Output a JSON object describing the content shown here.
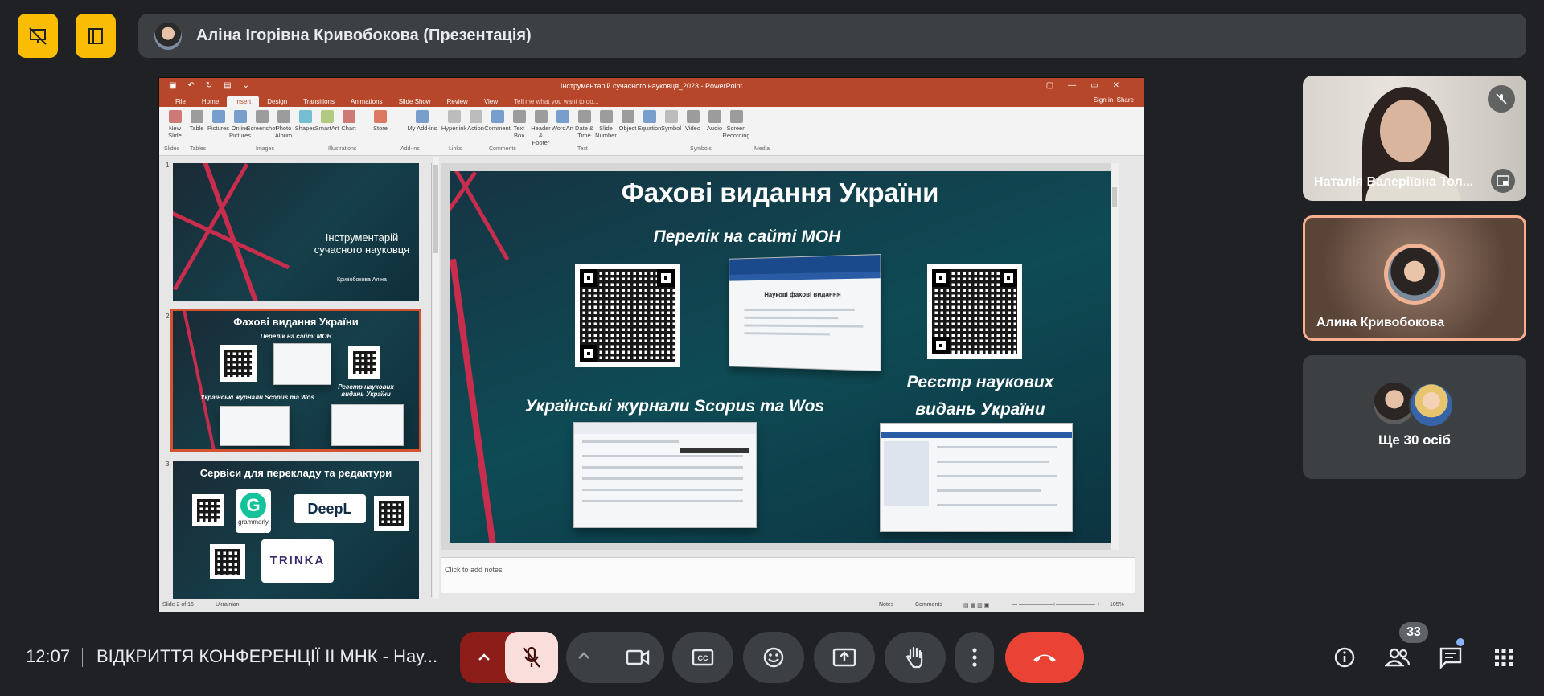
{
  "top": {
    "presenter_name": "Аліна Ігорівна Кривобокова (Презентація)"
  },
  "ppt": {
    "window_title": "Інструментарій сучасного науковця_2023 - PowerPoint",
    "tabs": [
      "File",
      "Home",
      "Insert",
      "Design",
      "Transitions",
      "Animations",
      "Slide Show",
      "Review",
      "View"
    ],
    "active_tab": "Insert",
    "tell_me": "Tell me what you want to do...",
    "sign_in": "Sign in",
    "share": "Share",
    "ribbon": [
      {
        "label": "New Slide"
      },
      {
        "label": "Table"
      },
      {
        "label": "Pictures"
      },
      {
        "label": "Online Pictures"
      },
      {
        "label": "Screenshot"
      },
      {
        "label": "Photo Album"
      },
      {
        "label": "Shapes"
      },
      {
        "label": "SmartArt"
      },
      {
        "label": "Chart"
      },
      {
        "label": "Store"
      },
      {
        "label": "My Add-ins"
      },
      {
        "label": "Hyperlink"
      },
      {
        "label": "Action"
      },
      {
        "label": "Comment"
      },
      {
        "label": "Text Box"
      },
      {
        "label": "Header & Footer"
      },
      {
        "label": "WordArt"
      },
      {
        "label": "Date & Time"
      },
      {
        "label": "Slide Number"
      },
      {
        "label": "Object"
      },
      {
        "label": "Equation"
      },
      {
        "label": "Symbol"
      },
      {
        "label": "Video"
      },
      {
        "label": "Audio"
      },
      {
        "label": "Screen Recording"
      }
    ],
    "ribbon_groups": [
      "Slides",
      "Tables",
      "Images",
      "Illustrations",
      "Add-ins",
      "Links",
      "Comments",
      "Text",
      "Symbols",
      "Media"
    ],
    "thumb1": {
      "num": "1",
      "title": "Інструментарій сучасного науковця",
      "author": "Кривобокова Аліна"
    },
    "thumb2": {
      "num": "2",
      "title": "Фахові видання України",
      "sub1": "Перелік на сайті МОН",
      "sub2": "Українські журнали Scopus та Wos",
      "sub3": "Реєстр наукових видань України"
    },
    "thumb3": {
      "num": "3",
      "title": "Сервіси для перекладу та редактури",
      "grammarly": "grammarly",
      "deepl": "DeepL",
      "trinka": "TRINKA"
    },
    "slide": {
      "title": "Фахові видання України",
      "sub_mon": "Перелік на сайті МОН",
      "sub_scopus": "Українські журнали Scopus та Wos",
      "sub_registry_1": "Реєстр наукових",
      "sub_registry_2": "видань України",
      "mon_screenshot_heading": "Наукові фахові видання"
    },
    "notes_placeholder": "Click to add notes",
    "status": {
      "slide": "Slide 2 of 16",
      "lang": "Ukrainian",
      "notes": "Notes",
      "comments": "Comments",
      "zoom": "105%"
    }
  },
  "participants": [
    {
      "name": "Наталія Валеріївна Тол..."
    },
    {
      "name": "Алина Кривобокова"
    },
    {
      "name": "Ще 30 осіб"
    }
  ],
  "bottom": {
    "time": "12:07",
    "meeting_title": "ВІДКРИТТЯ КОНФЕРЕНЦІЇ ІІ МНК - Нау...",
    "participants_count": "33"
  },
  "colors": {
    "accent": "#fbbc04",
    "end_call": "#ea4335",
    "mic_off_bg": "#f9dedc",
    "ppt_red": "#b7472a"
  }
}
